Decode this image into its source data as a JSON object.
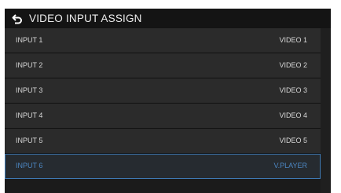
{
  "header": {
    "back_icon": "back-arrow-icon",
    "title": "VIDEO INPUT ASSIGN"
  },
  "rows": [
    {
      "input": "INPUT 1",
      "value": "VIDEO 1"
    },
    {
      "input": "INPUT 2",
      "value": "VIDEO 2"
    },
    {
      "input": "INPUT 3",
      "value": "VIDEO 3"
    },
    {
      "input": "INPUT 4",
      "value": "VIDEO 4"
    },
    {
      "input": "INPUT 5",
      "value": "VIDEO 5"
    },
    {
      "input": "INPUT 6",
      "value": "V.PLAYER"
    }
  ],
  "selected_row": "INPUT 6",
  "colors": {
    "background": "#1b1b1b",
    "row": "#2b2b2b",
    "accent": "#4c87c3",
    "text": "#d8d8d8"
  }
}
